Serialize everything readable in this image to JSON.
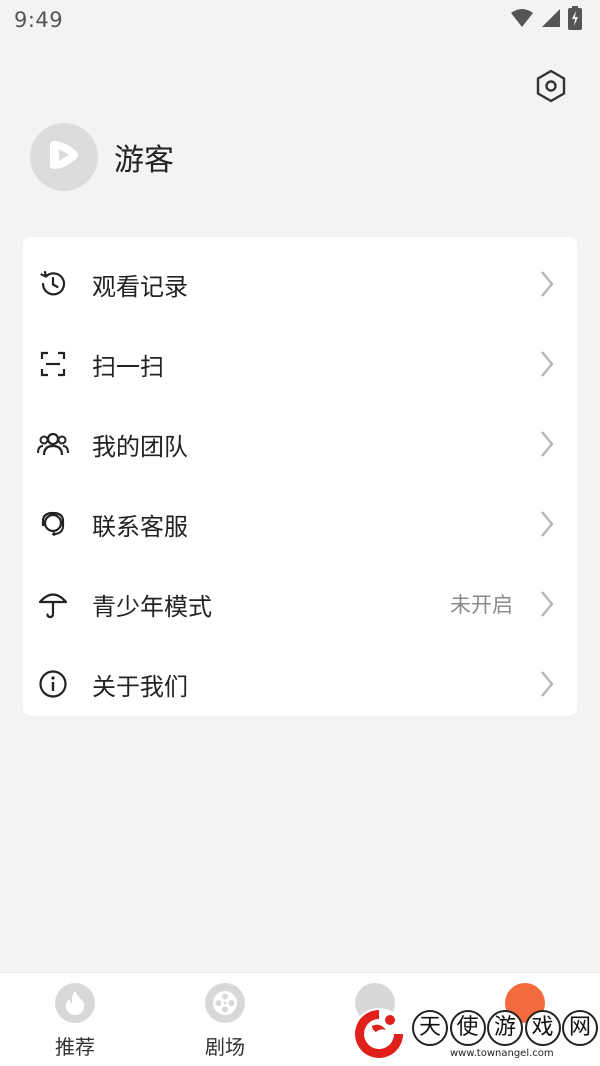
{
  "status_bar": {
    "time": "9:49"
  },
  "profile": {
    "username": "游客"
  },
  "menu": {
    "items": [
      {
        "label": "观看记录",
        "icon": "history-clock-icon"
      },
      {
        "label": "扫一扫",
        "icon": "scan-icon"
      },
      {
        "label": "我的团队",
        "icon": "team-icon"
      },
      {
        "label": "联系客服",
        "icon": "headset-icon"
      },
      {
        "label": "青少年模式",
        "icon": "umbrella-icon",
        "value": "未开启"
      },
      {
        "label": "关于我们",
        "icon": "info-icon"
      }
    ]
  },
  "bottom_nav": {
    "items": [
      {
        "label": "推荐",
        "icon": "flame-icon"
      },
      {
        "label": "剧场",
        "icon": "film-reel-icon"
      },
      {
        "label": "",
        "icon": "partial-nav-icon"
      },
      {
        "label": "",
        "icon": "partial-nav-icon-active"
      }
    ]
  },
  "watermark": {
    "chars": [
      "天",
      "使",
      "游",
      "戏",
      "网"
    ],
    "url": "www.townangel.com"
  },
  "colors": {
    "background": "#f4f3f1",
    "card": "#ffffff",
    "accent": "#f26a3d",
    "logo_red": "#e0201a"
  }
}
